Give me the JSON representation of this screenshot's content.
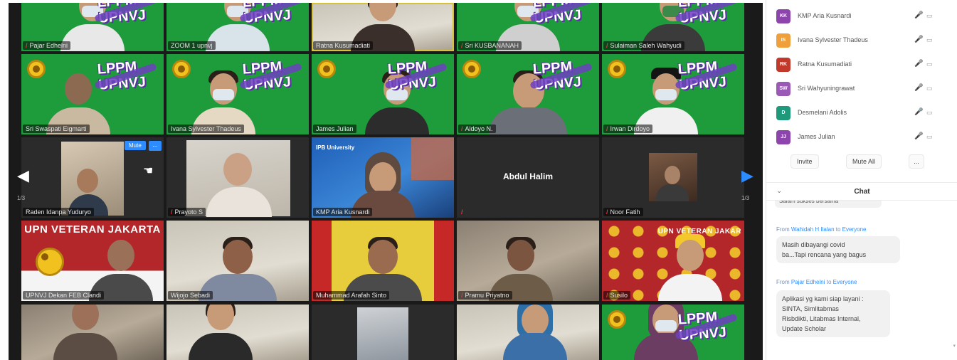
{
  "gallery": {
    "tiles": [
      {
        "name": "Pajar Edhelni",
        "muted": true
      },
      {
        "name": "ZOOM 1 upnvj",
        "muted": false
      },
      {
        "name": "Ratna Kusumadiati",
        "muted": false
      },
      {
        "name": "Sri KUSBANANAH",
        "muted": true
      },
      {
        "name": "Sulaiman Saleh Wahyudi",
        "muted": true
      },
      {
        "name": "Sri Swaspati Eigmarti",
        "muted": false
      },
      {
        "name": "Ivana Sylvester Thadeus",
        "muted": false
      },
      {
        "name": "James Julian",
        "muted": false
      },
      {
        "name": "Aldoyo N.",
        "muted": true
      },
      {
        "name": "Irwan Dirdoyo",
        "muted": true
      },
      {
        "name": "Raden Idanpa Yuduryo",
        "muted": false
      },
      {
        "name": "Prayoto S",
        "muted": true
      },
      {
        "name": "KMP Aria Kusnardi",
        "muted": false
      },
      {
        "name": "Abdul Halim",
        "muted": true
      },
      {
        "name": "Noor Fatih",
        "muted": true
      },
      {
        "name": "UPNVJ Dekan FEB Clandi",
        "muted": false
      },
      {
        "name": "Wijojo Sebadi",
        "muted": false
      },
      {
        "name": "Muhammad Arafah Sinto",
        "muted": false
      },
      {
        "name": "Pramu Priyatno",
        "muted": true
      },
      {
        "name": "Susilo",
        "muted": true
      }
    ],
    "lppm_line1": "LPPM",
    "lppm_line2": "UPNVJ",
    "center_name": "Abdul Halim",
    "upn_banner": "UPN VETERAN JAKARTA",
    "upn_banner_2": "UPN VETERAN JAKAR",
    "mute_button": "Mute",
    "more_button": "...",
    "page_left": "1/3",
    "page_right": "1/3",
    "arrow_left": "◀",
    "arrow_right": "▶"
  },
  "participants": {
    "items": [
      {
        "initials": "KK",
        "name": "KMP Aria Kusnardi",
        "color": "#8e44ad",
        "mic": "normal"
      },
      {
        "initials": "IS",
        "name": "Ivana Sylvester Thadeus",
        "color": "#f0a03b",
        "mic": "normal"
      },
      {
        "initials": "RK",
        "name": "Ratna Kusumadiati",
        "color": "#c0392b",
        "mic": "speaking"
      },
      {
        "initials": "SW",
        "name": "Sri Wahyuningrawat",
        "color": "#9b59b6",
        "mic": "normal"
      },
      {
        "initials": "D",
        "name": "Desmelani Adolis",
        "color": "#1e9a7a",
        "mic": "muted"
      },
      {
        "initials": "JJ",
        "name": "James Julian",
        "color": "#8e44ad",
        "mic": "normal"
      }
    ],
    "invite_label": "Invite",
    "mute_all_label": "Mute All",
    "more_label": "..."
  },
  "chat": {
    "title": "Chat",
    "collapse_icon": "⌄",
    "cut_message": "Salam sukses bersama",
    "messages": [
      {
        "from_label": "From",
        "from": "Wahidah H Ilalan",
        "to_label": "to",
        "to": "Everyone",
        "text_lines": [
          "Masih dibayangi covid",
          "ba...Tapi rencana yang bagus"
        ]
      },
      {
        "from_label": "From",
        "from": "Pajar Edhelni",
        "to_label": "to",
        "to": "Everyone",
        "text_lines": [
          "Aplikasi yg kami siap layani :",
          "SINTA, Simlitabmas",
          "Risbdikti, Litabmas Internal,",
          "Update Scholar"
        ]
      }
    ]
  },
  "icons": {
    "mic": "🎤",
    "cam": "▭"
  }
}
